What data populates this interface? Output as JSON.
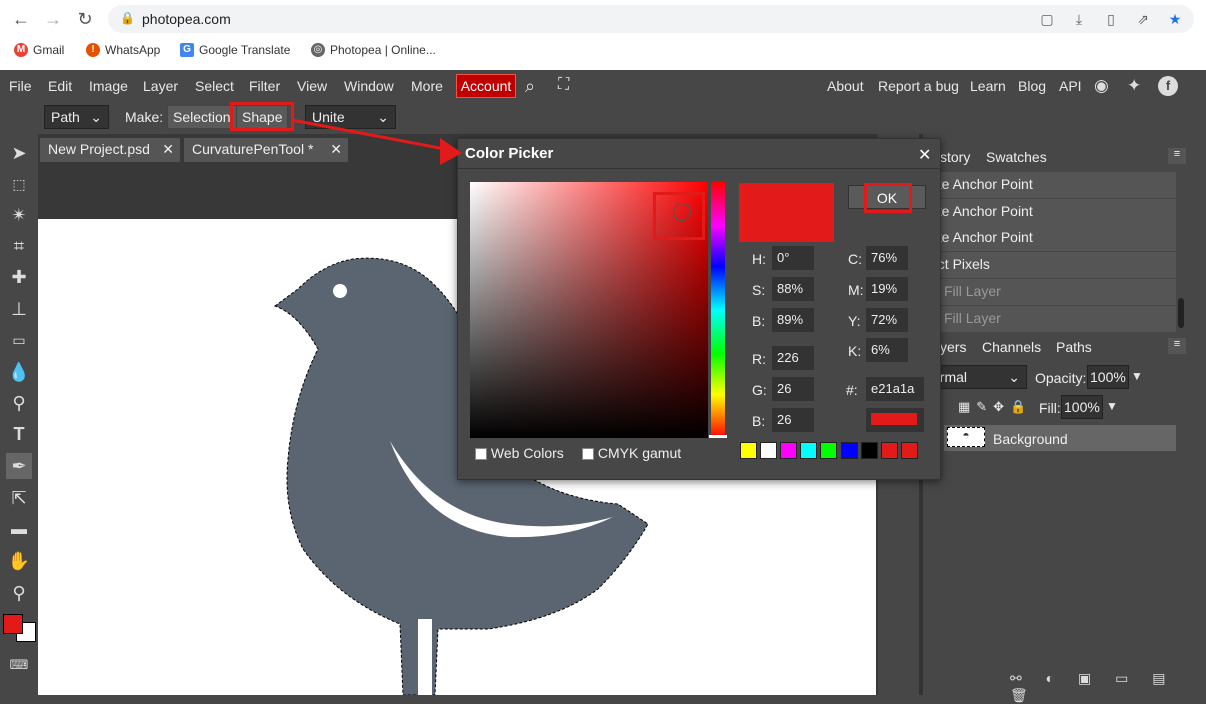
{
  "browser": {
    "url": "photopea.com",
    "bookmarks": [
      "Gmail",
      "WhatsApp",
      "Google Translate",
      "Photopea | Online..."
    ]
  },
  "menu": [
    "File",
    "Edit",
    "Image",
    "Layer",
    "Select",
    "Filter",
    "View",
    "Window",
    "More"
  ],
  "account_label": "Account",
  "right_links": [
    "About",
    "Report a bug",
    "Learn",
    "Blog",
    "API"
  ],
  "options": {
    "path_mode": "Path",
    "make_label": "Make:",
    "selection_label": "Selection",
    "shape_label": "Shape",
    "op_mode": "Unite"
  },
  "tabs": [
    {
      "label": "New Project.psd",
      "close": "✕"
    },
    {
      "label": "CurvaturePenTool  *",
      "close": "✕"
    }
  ],
  "panels": {
    "history_tab": "story",
    "swatches_tab": "Swatches",
    "history": [
      {
        "label": "ete Anchor Point",
        "dim": false
      },
      {
        "label": "ete Anchor Point",
        "dim": false
      },
      {
        "label": "ete Anchor Point",
        "dim": false
      },
      {
        "label": "ect Pixels",
        "dim": false
      },
      {
        "label": "w Fill Layer",
        "dim": true
      },
      {
        "label": "w Fill Layer",
        "dim": true
      }
    ],
    "layers_tab": "yers",
    "channels_tab": "Channels",
    "paths_tab": "Paths",
    "blend_mode": "ormal",
    "opacity_label": "Opacity:",
    "opacity_value": "100%",
    "lock_label": "k:",
    "fill_label": "Fill:",
    "fill_value": "100%",
    "layer_name": "Background"
  },
  "dialog": {
    "title": "Color Picker",
    "close": "✕",
    "ok_label": "OK",
    "hsb": [
      {
        "label": "H:",
        "value": "0°"
      },
      {
        "label": "S:",
        "value": "88%"
      },
      {
        "label": "B:",
        "value": "89%"
      }
    ],
    "rgb": [
      {
        "label": "R:",
        "value": "226"
      },
      {
        "label": "G:",
        "value": "26"
      },
      {
        "label": "B:",
        "value": "26"
      }
    ],
    "cmyk": [
      {
        "label": "C:",
        "value": "76%"
      },
      {
        "label": "M:",
        "value": "19%"
      },
      {
        "label": "Y:",
        "value": "72%"
      },
      {
        "label": "K:",
        "value": "6%"
      }
    ],
    "hex_label": "#:",
    "hex_value": "e21a1a",
    "web_colors_label": "Web Colors",
    "cmyk_gamut_label": "CMYK gamut",
    "current_color": "#e21a1a",
    "swatches": [
      "#ffff00",
      "#ffffff",
      "#ff00ff",
      "#00ffff",
      "#00ff00",
      "#0000ff",
      "#000000",
      "#e21a1a",
      "#e21a1a"
    ]
  }
}
